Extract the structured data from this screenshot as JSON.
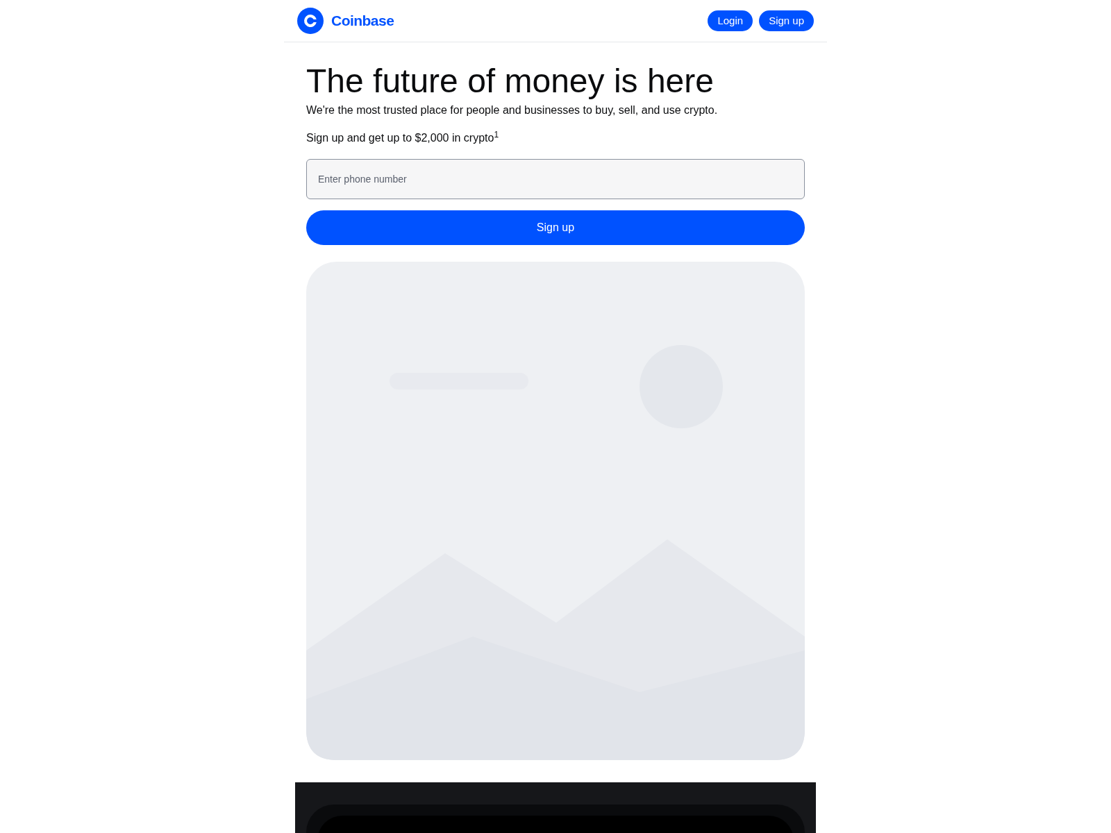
{
  "header": {
    "brand": "Coinbase",
    "buttons": [
      "Login",
      "Sign up"
    ]
  },
  "hero": {
    "title": "The future of money is here",
    "subtitle": "We're the most trusted place for people and businesses to buy, sell, and use crypto.",
    "offer": "Sign up and get up to $2,000 in crypto$^{1}$",
    "phone": {
      "placeholder": "Enter phone number"
    },
    "cta": "Sign up"
  }
}
